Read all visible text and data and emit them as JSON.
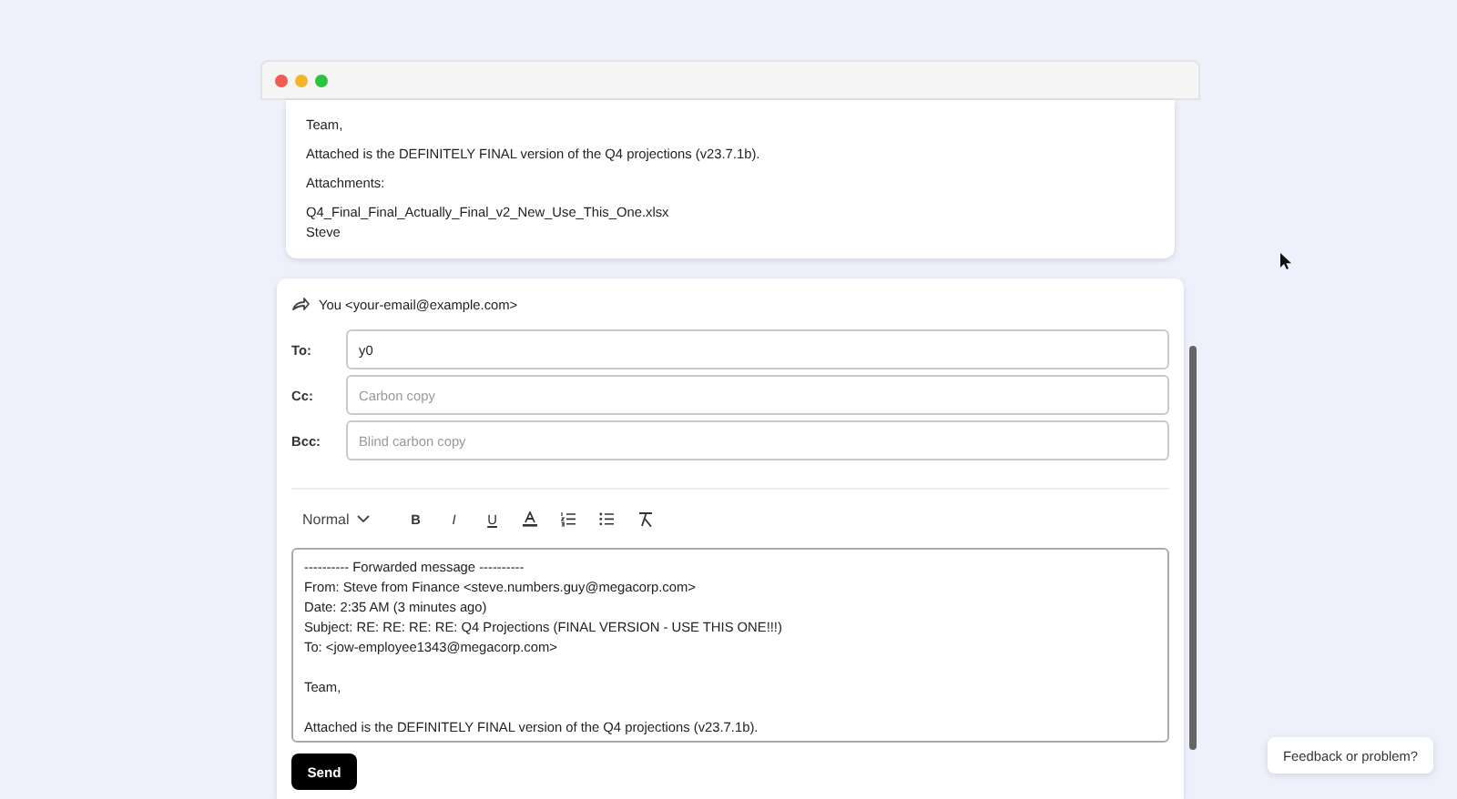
{
  "window": {
    "controls": [
      {
        "color": "#f25a52"
      },
      {
        "color": "#f6b42d"
      },
      {
        "color": "#2bc240"
      }
    ]
  },
  "previous_message": {
    "paragraphs": [
      [
        "Team,"
      ],
      [
        "Attached is the DEFINITELY FINAL version of the Q4 projections (v23.7.1b)."
      ],
      [
        "Attachments:"
      ],
      [
        "Q4_Final_Final_Actually_Final_v2_New_Use_This_One.xlsx",
        "Steve"
      ]
    ]
  },
  "compose": {
    "sender": "You <your-email@example.com>",
    "fields": [
      {
        "label": "To:",
        "value": "y0"
      },
      {
        "label": "Cc:",
        "placeholder": "Carbon copy"
      },
      {
        "label": "Bcc:",
        "placeholder": "Blind carbon copy"
      }
    ],
    "toolbar": {
      "style": "Normal",
      "buttons": [
        {
          "kind": "bold",
          "label": "B"
        },
        {
          "kind": "italic",
          "label": "I"
        },
        {
          "kind": "underline",
          "label": "U"
        },
        {
          "kind": "text-color"
        },
        {
          "kind": "ordered-list"
        },
        {
          "kind": "bullet-list"
        },
        {
          "kind": "clear-format"
        }
      ]
    },
    "body": [
      [
        "---------- Forwarded message ----------",
        "From: Steve from Finance <steve.numbers.guy@megacorp.com>",
        "Date: 2:35 AM (3 minutes ago)",
        "Subject: RE: RE: RE: RE: Q4 Projections (FINAL VERSION - USE THIS ONE!!!)",
        "To: <jow-employee1343@megacorp.com>"
      ],
      [
        "Team,"
      ],
      [
        "Attached is the DEFINITELY FINAL version of the Q4 projections (v23.7.1b)."
      ]
    ],
    "send": "Send"
  },
  "feedback_button": "Feedback or problem?"
}
